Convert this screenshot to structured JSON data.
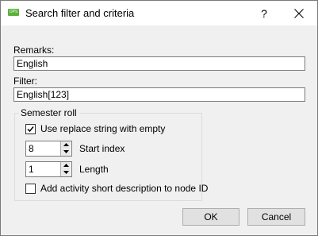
{
  "window": {
    "title": "Search filter and criteria",
    "icon": "app-icon",
    "help_label": "?",
    "close_icon": "close-icon"
  },
  "form": {
    "remarks_label": "Remarks:",
    "remarks_value": "English",
    "filter_label": "Filter:",
    "filter_value": "English[123]"
  },
  "semester_roll": {
    "legend": "Semester roll",
    "use_replace_label": "Use replace string with empty",
    "use_replace_checked": true,
    "start_index_value": "8",
    "start_index_label": "Start index",
    "length_value": "1",
    "length_label": "Length",
    "add_activity_label": "Add activity short description to node ID",
    "add_activity_checked": false
  },
  "buttons": {
    "ok": "OK",
    "cancel": "Cancel"
  }
}
